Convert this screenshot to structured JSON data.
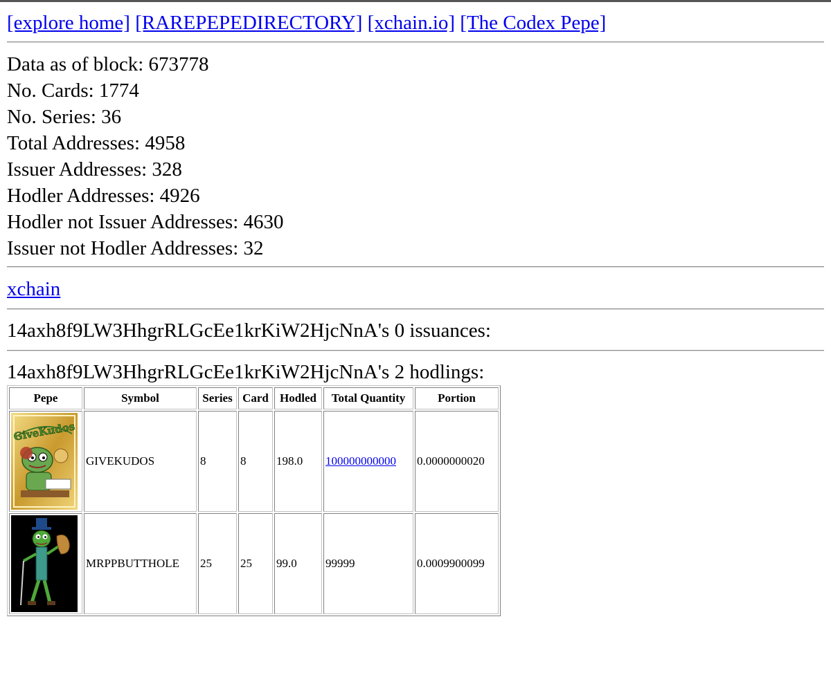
{
  "nav": {
    "links": [
      "[explore home]",
      "[RAREPEPEDIRECTORY]",
      "[xchain.io]",
      "[The Codex Pepe]"
    ]
  },
  "stats": [
    "Data as of block: 673778",
    "No. Cards: 1774",
    "No. Series: 36",
    "Total Addresses: 4958",
    "Issuer Addresses: 328",
    "Hodler Addresses: 4926",
    "Hodler not Issuer Addresses: 4630",
    "Issuer not Hodler Addresses: 32"
  ],
  "xchain_link": "xchain",
  "issuances_heading": "14axh8f9LW3HhgrRLGcEe1krKiW2HjcNnA's 0 issuances:",
  "hodlings_heading": "14axh8f9LW3HhgrRLGcEe1krKiW2HjcNnA's 2 hodlings:",
  "table": {
    "headers": [
      "Pepe",
      "Symbol",
      "Series",
      "Card",
      "Hodled",
      "Total Quantity",
      "Portion"
    ],
    "rows": [
      {
        "image_icon": "givekudos-card-image",
        "image_text": "GiveKudos",
        "symbol": "GIVEKUDOS",
        "series": "8",
        "card": "8",
        "hodled": "198.0",
        "total_quantity": "100000000000",
        "portion": "0.0000000020"
      },
      {
        "image_icon": "mrppbutthole-card-image",
        "image_text": "",
        "symbol": "MRPPBUTTHOLE",
        "series": "25",
        "card": "25",
        "hodled": "99.0",
        "total_quantity": "99999",
        "portion": "0.0009900099"
      }
    ]
  },
  "colors": {
    "link": "#0000ee",
    "rule": "#8a8a8a",
    "gold": "#d8b640",
    "dark_card": "#000000"
  }
}
